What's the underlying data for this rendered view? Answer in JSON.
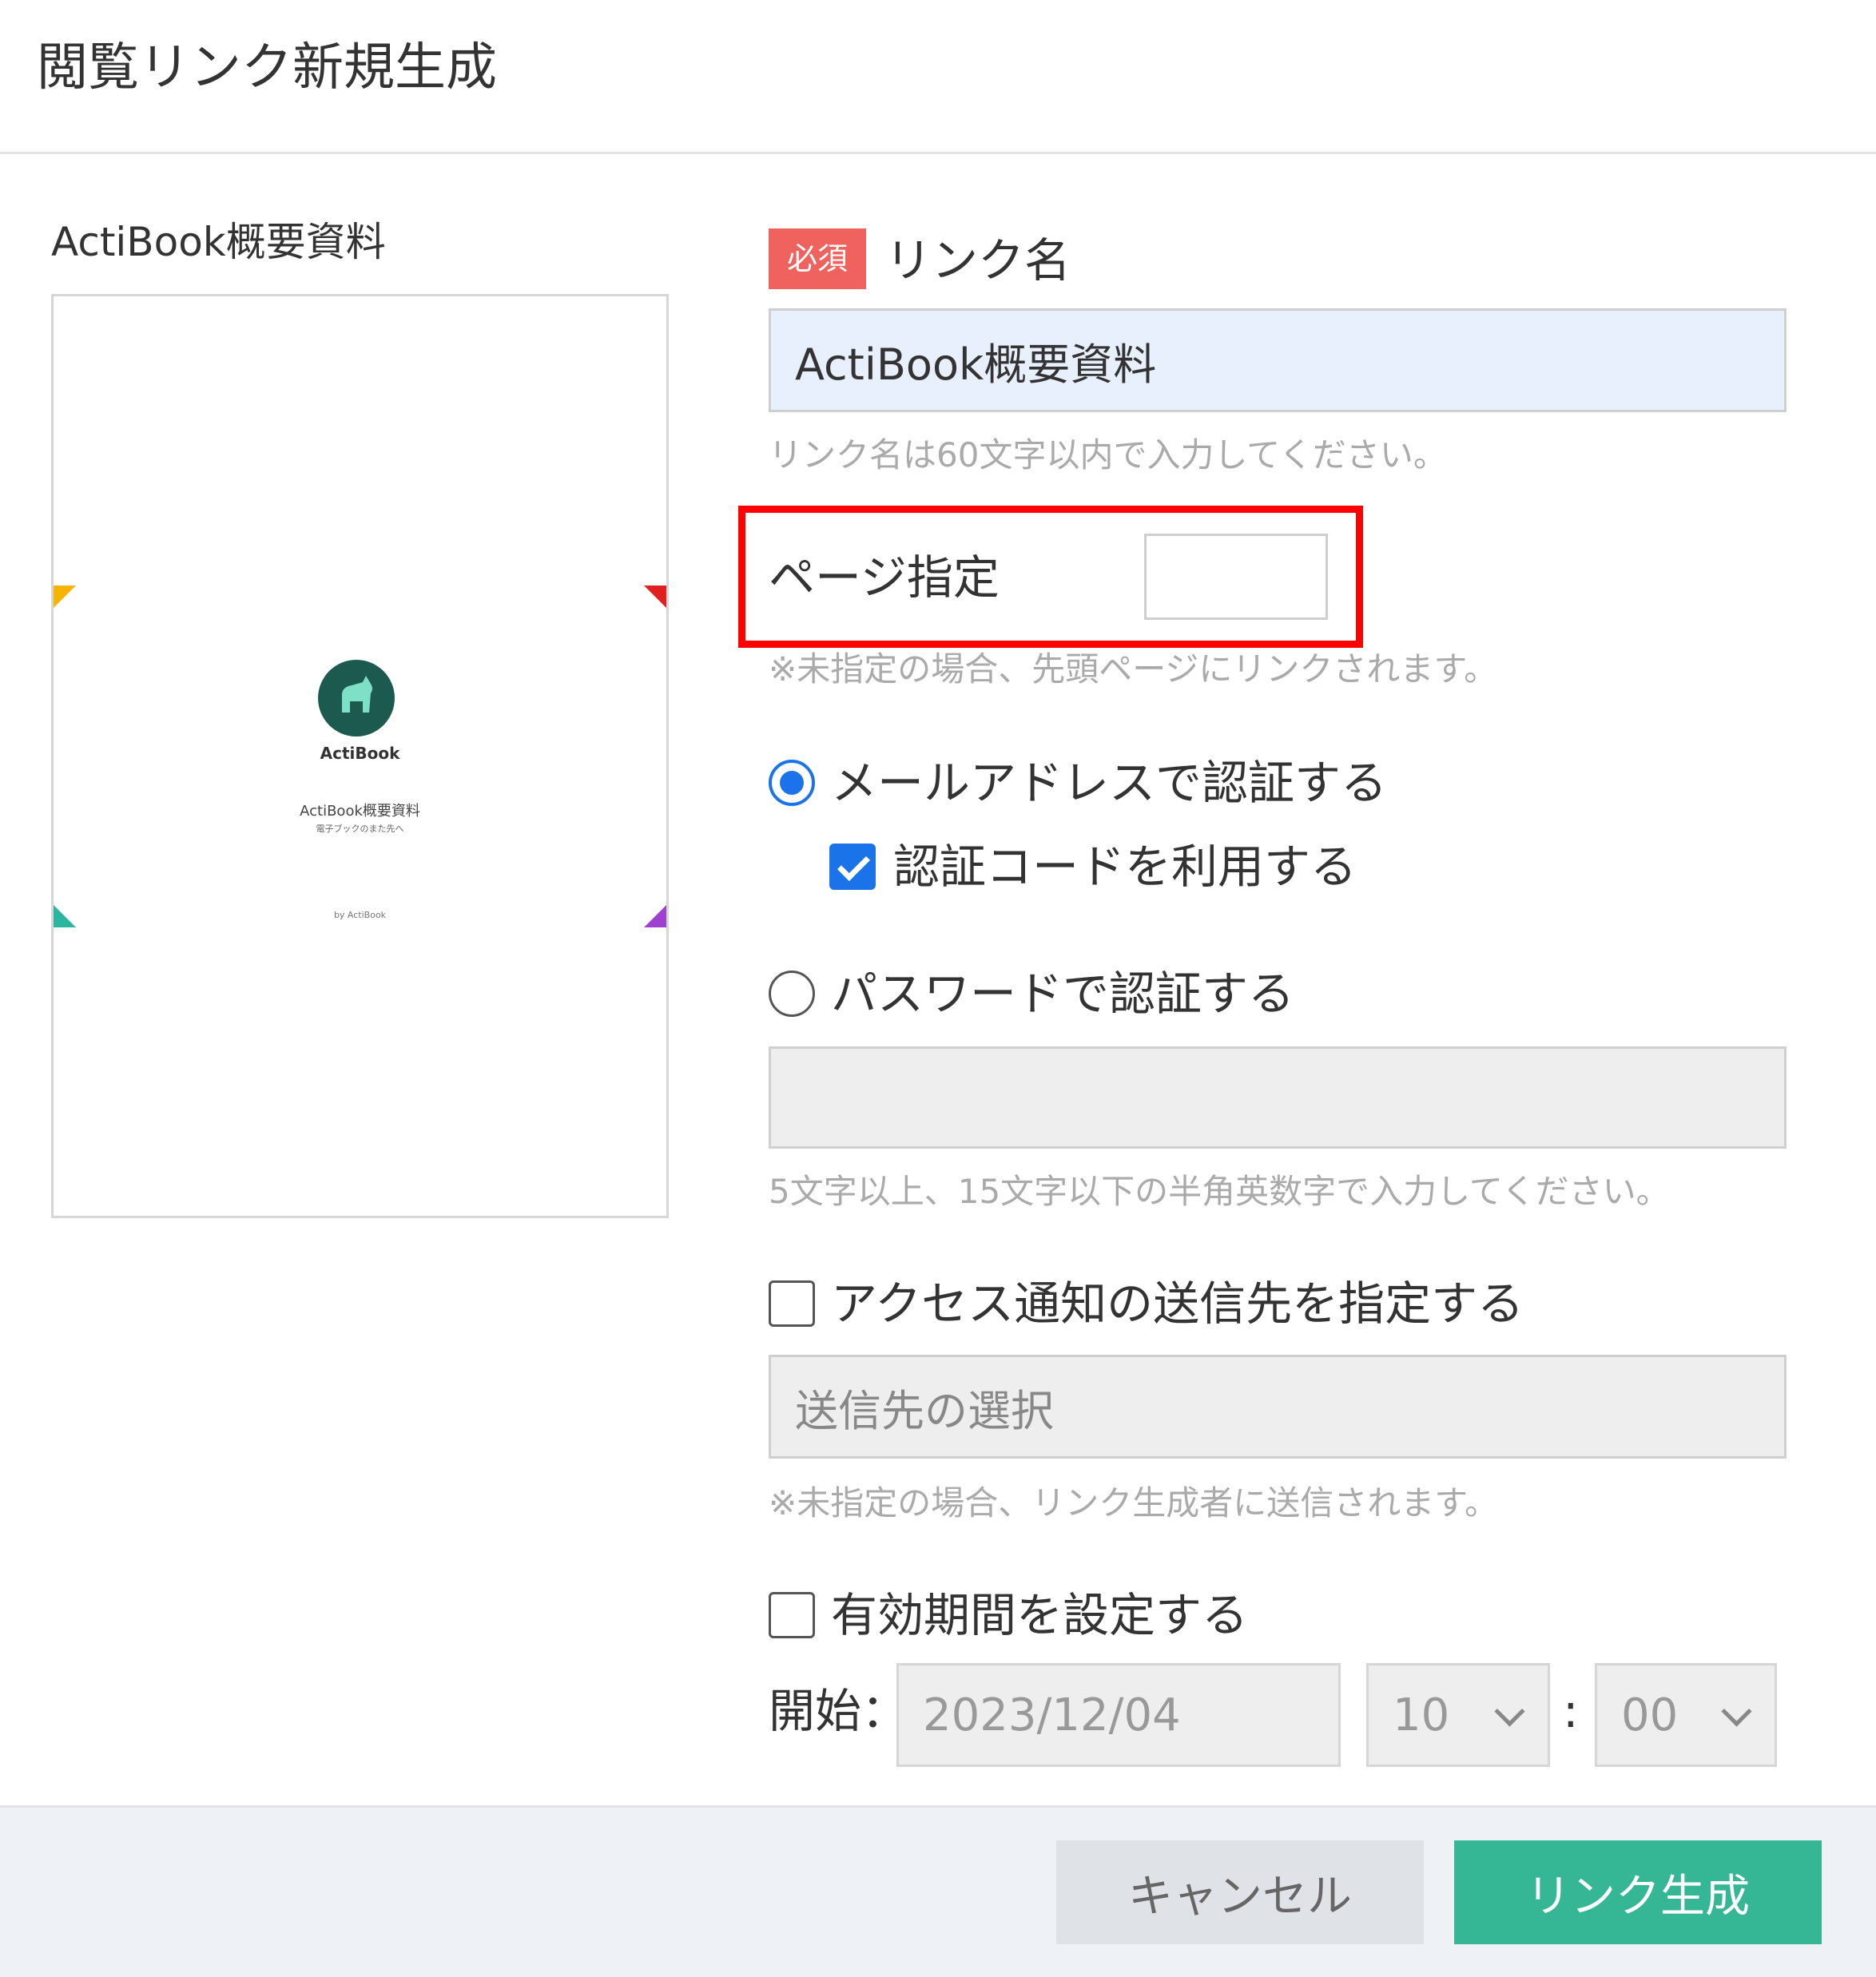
{
  "dialog": {
    "title": "閲覧リンク新規生成"
  },
  "preview": {
    "document_name": "ActiBook概要資料",
    "cover": {
      "logo_text": "ActiBook",
      "title": "ActiBook概要資料",
      "subtitle": "電子ブックのまた先へ",
      "footer": "by ActiBook"
    }
  },
  "form": {
    "required_badge": "必須",
    "link_name_label": "リンク名",
    "link_name_value": "ActiBook概要資料",
    "link_name_hint": "リンク名は60文字以内で入力してください。",
    "page_label": "ページ指定",
    "page_value": "",
    "page_hint": "※未指定の場合、先頭ページにリンクされます。",
    "auth_email_label": "メールアドレスで認証する",
    "auth_email_selected": true,
    "auth_code_label": "認証コードを利用する",
    "auth_code_checked": true,
    "auth_password_label": "パスワードで認証する",
    "auth_password_selected": false,
    "password_value": "",
    "password_hint": "5文字以上、15文字以下の半角英数字で入力してください。",
    "notify_label": "アクセス通知の送信先を指定する",
    "notify_checked": false,
    "notify_placeholder": "送信先の選択",
    "notify_hint": "※未指定の場合、リンク生成者に送信されます。",
    "expiry_label": "有効期間を設定する",
    "expiry_checked": false,
    "start_label": "開始：",
    "start_date": "2023/12/04",
    "start_hour": "10",
    "time_separator": ":",
    "start_minute": "00"
  },
  "footer": {
    "cancel_label": "キャンセル",
    "create_label": "リンク生成"
  },
  "colors": {
    "accent": "#1a73e8",
    "create_button": "#35b694",
    "required_badge": "#f0625e",
    "highlight_box": "#ff0000"
  }
}
